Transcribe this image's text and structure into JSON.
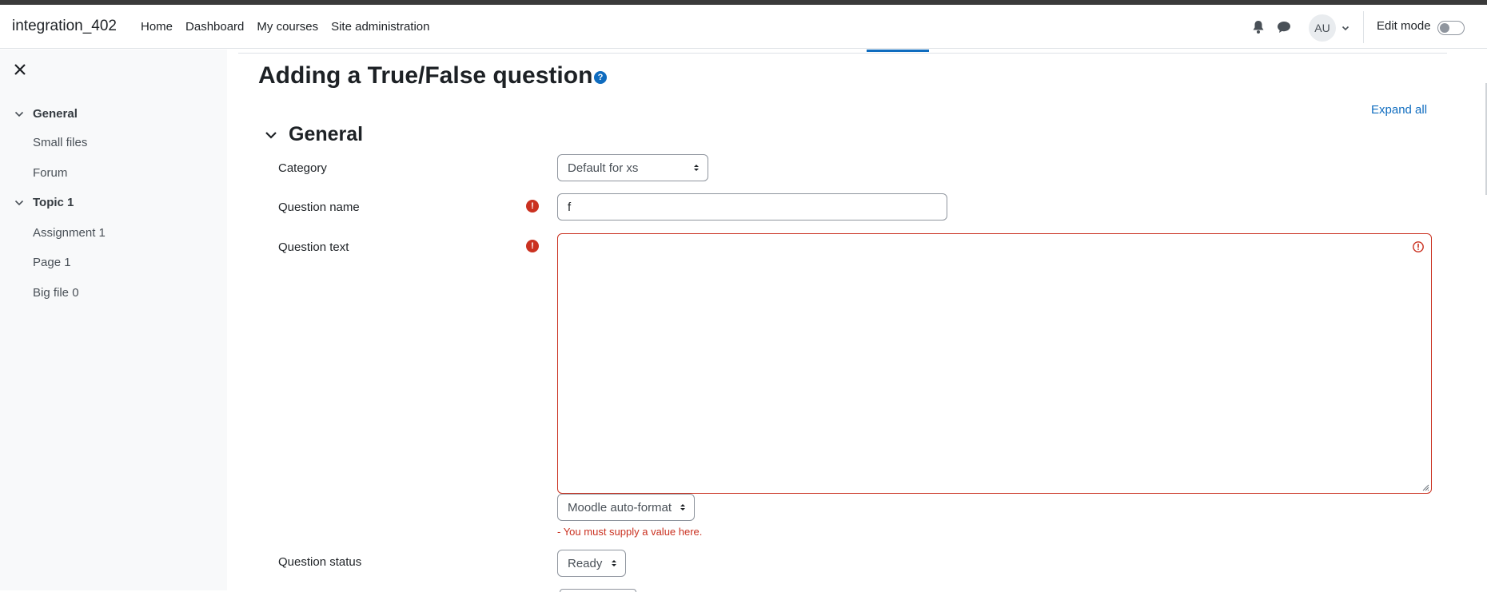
{
  "navbar": {
    "brand": "integration_402",
    "links": [
      "Home",
      "Dashboard",
      "My courses",
      "Site administration"
    ],
    "icons": [
      "bell-icon",
      "chat-icon"
    ],
    "avatar_initials": "AU",
    "edit_mode_label": "Edit mode",
    "edit_mode_on": false
  },
  "drawer": {
    "sections": [
      {
        "title": "General",
        "items": [
          "Small files",
          "Forum"
        ]
      },
      {
        "title": "Topic 1",
        "items": [
          "Assignment 1",
          "Page 1",
          "Big file 0"
        ]
      }
    ]
  },
  "main": {
    "page_title": "Adding a True/False question",
    "expand_all": "Expand all",
    "section_title": "General",
    "fields": {
      "category": {
        "label": "Category",
        "value": "Default for xs"
      },
      "question_name": {
        "label": "Question name",
        "value": "f"
      },
      "question_text": {
        "label": "Question text",
        "value": "",
        "format": "Moodle auto-format",
        "error": "- You must supply a value here."
      },
      "question_status": {
        "label": "Question status",
        "value": "Ready"
      }
    },
    "required_icon_glyph": "!",
    "help_icon_glyph": "?"
  },
  "colors": {
    "accent": "#0f6cbf",
    "error": "#ca3120",
    "drawer_bg": "#f8f9fa",
    "text": "#1d2125"
  }
}
